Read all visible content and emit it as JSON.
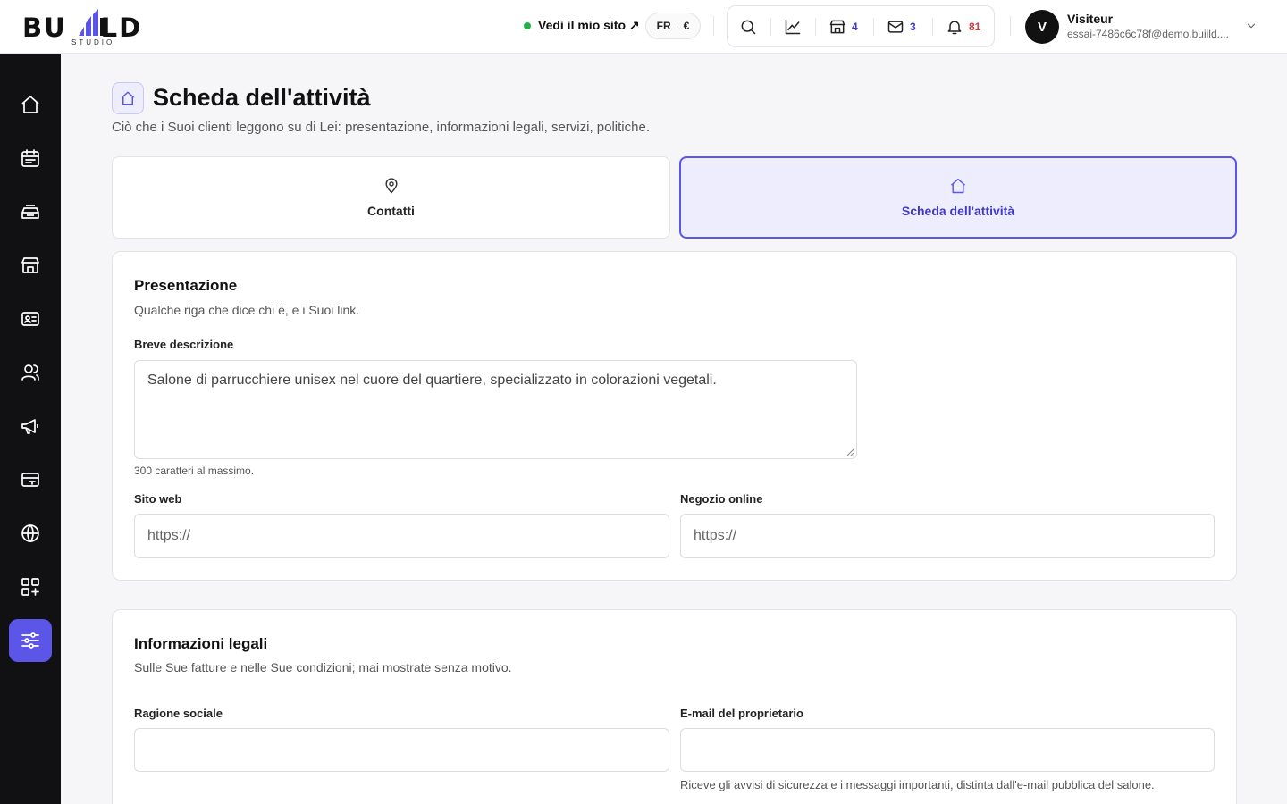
{
  "brand": {
    "logo_text": "BUILD",
    "logo_sub": "STUDIO"
  },
  "topbar": {
    "site_link": "Vedi il mio sito ↗",
    "lang": "FR",
    "currency": "€",
    "counts": {
      "stores": "4",
      "messages": "3",
      "notifications": "81"
    }
  },
  "user": {
    "initial": "V",
    "name": "Visiteur",
    "email": "essai-7486c6c78f@demo.buiild...."
  },
  "sidebar": {
    "items": [
      {
        "icon": "home-icon"
      },
      {
        "icon": "calendar-icon"
      },
      {
        "icon": "inbox-icon"
      },
      {
        "icon": "store-icon"
      },
      {
        "icon": "contact-card-icon"
      },
      {
        "icon": "users-icon"
      },
      {
        "icon": "megaphone-icon"
      },
      {
        "icon": "card-icon"
      },
      {
        "icon": "globe-icon"
      },
      {
        "icon": "apps-icon"
      },
      {
        "icon": "settings-sliders-icon",
        "active": true
      }
    ]
  },
  "page": {
    "title": "Scheda dell'attività",
    "subtitle": "Ciò che i Suoi clienti leggono su di Lei: presentazione, informazioni legali, servizi, politiche."
  },
  "tabs": {
    "contacts": "Contatti",
    "activity": "Scheda dell'attività"
  },
  "presentation": {
    "title": "Presentazione",
    "subtitle": "Qualche riga che dice chi è, e i Suoi link.",
    "description_label": "Breve descrizione",
    "description_value": "Salone di parrucchiere unisex nel cuore del quartiere, specializzato in colorazioni vegetali.",
    "description_hint": "300 caratteri al massimo.",
    "website_label": "Sito web",
    "website_value": "https://",
    "shop_label": "Negozio online",
    "shop_value": "https://"
  },
  "legal": {
    "title": "Informazioni legali",
    "subtitle": "Sulle Sue fatture e nelle Sue condizioni; mai mostrate senza motivo.",
    "company_label": "Ragione sociale",
    "company_value": "",
    "owner_email_label": "E-mail del proprietario",
    "owner_email_value": "",
    "owner_email_hint": "Riceve gli avvisi di sicurezza e i messaggi importanti, distinta dall'e-mail pubblica del salone."
  },
  "colors": {
    "accent": "#5b55e8",
    "accent_soft": "#eeedfd",
    "sidebar_bg": "#111114",
    "online": "#22b04b",
    "notif": "#d63a3a"
  }
}
